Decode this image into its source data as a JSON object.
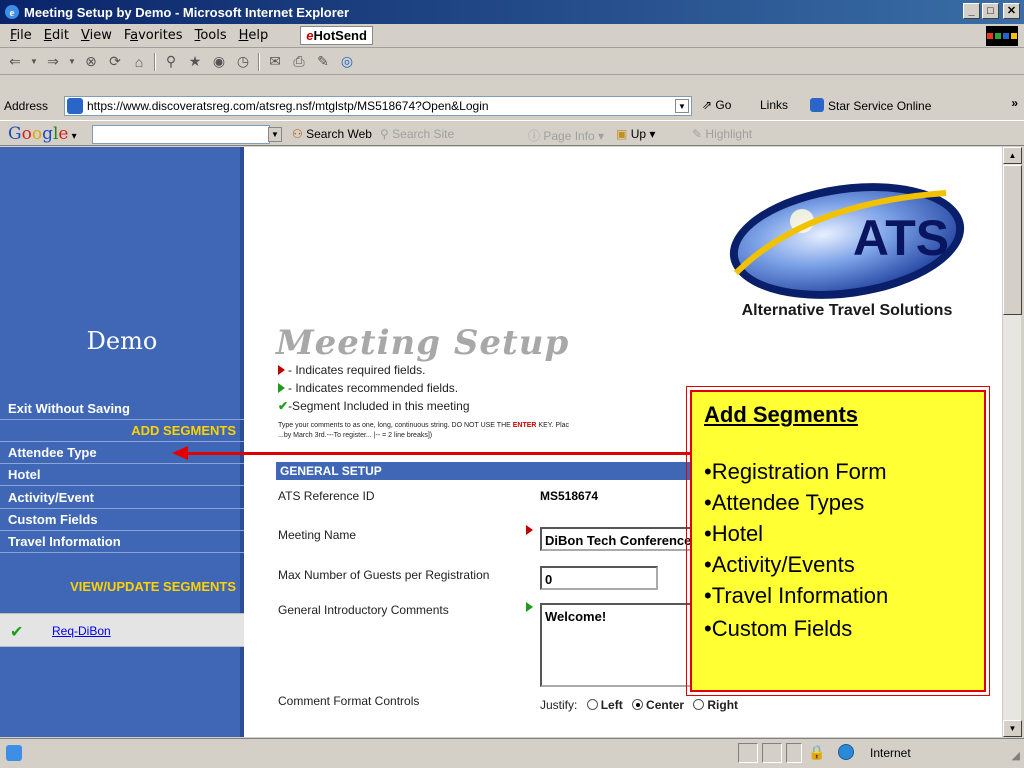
{
  "window": {
    "title": "Meeting Setup by Demo - Microsoft Internet Explorer",
    "min": "_",
    "max": "□",
    "close": "✕"
  },
  "menu": {
    "items": [
      {
        "label": "File",
        "u": "F",
        "rest": "ile"
      },
      {
        "label": "Edit",
        "u": "E",
        "rest": "dit"
      },
      {
        "label": "View",
        "u": "V",
        "rest": "iew"
      },
      {
        "label": "Favorites",
        "pre": "F",
        "u": "a",
        "rest": "vorites"
      },
      {
        "label": "Tools",
        "u": "T",
        "rest": "ools"
      },
      {
        "label": "Help",
        "u": "H",
        "rest": "elp"
      }
    ],
    "hotsend": "HotSend"
  },
  "address": {
    "label": "Address",
    "url": "https://www.discoveratsreg.com/atsreg.nsf/mtglstp/MS518674?Open&Login",
    "go": "Go",
    "links": "Links",
    "star_link": "Star Service Online",
    "more": "»"
  },
  "googlebar": {
    "search_web": "Search Web",
    "search_site": "Search Site",
    "page_info": "Page Info",
    "up": "Up",
    "highlight": "Highlight"
  },
  "sidebar": {
    "title": "Demo",
    "exit": "Exit Without Saving",
    "add_segments": "ADD SEGMENTS",
    "items": [
      "Attendee Type",
      "Hotel",
      "Activity/Event",
      "Custom Fields",
      "Travel Information"
    ],
    "view_update": "VIEW/UPDATE SEGMENTS",
    "segment_link": "Req-DiBon"
  },
  "logo": {
    "brand": "ATS",
    "tagline": "Alternative Travel Solutions"
  },
  "main": {
    "title": "Meeting Setup",
    "legend_required": "- Indicates required fields.",
    "legend_recommended": "- Indicates recommended fields.",
    "legend_included": "-Segment Included in this meeting",
    "note_pre": "Type your comments to as one, long, continuous string. DO NOT USE THE ",
    "note_enter": "ENTER",
    "note_post": " KEY. Plac",
    "note_line2": "...by March 3rd.---To register... |-- = 2 line breaks])",
    "section": "GENERAL SETUP",
    "ref_label": "ATS Reference ID",
    "ref_value": "MS518674",
    "name_label": "Meeting Name",
    "name_value": "DiBon Tech Conference",
    "guests_label": "Max Number of Guests per Registration",
    "guests_value": "0",
    "intro_label": "General Introductory Comments",
    "intro_value": "Welcome!",
    "format_label": "Comment Format Controls",
    "justify_label": "Justify:",
    "justify_options": [
      "Left",
      "Center",
      "Right"
    ],
    "justify_selected": "Center"
  },
  "callout": {
    "title": "Add Segments",
    "items": [
      "Registration Form",
      "Attendee Types",
      "Hotel",
      "Activity/Events",
      "Travel Information",
      "Custom Fields"
    ]
  },
  "status": {
    "zone": "Internet"
  },
  "colors": {
    "sidebar_bg": "#3f67b5",
    "accent_yellow": "#ffd200",
    "callout_bg": "#ffff33",
    "callout_border": "#e00000"
  }
}
